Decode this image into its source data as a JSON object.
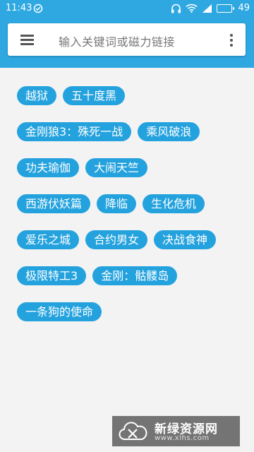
{
  "status_bar": {
    "time": "11:43",
    "battery": "49",
    "icons": [
      "check-circle-icon",
      "headphones-icon",
      "wifi-icon",
      "signal-icon",
      "battery-icon"
    ]
  },
  "search": {
    "placeholder": "输入关键词或磁力链接",
    "left_icon": "menu-icon",
    "right_icon": "more-vertical-icon"
  },
  "tags": [
    "越狱",
    "五十度黑",
    "金刚狼3：殊死一战",
    "乘风破浪",
    "功夫瑜伽",
    "大闹天竺",
    "西游伏妖篇",
    "降临",
    "生化危机",
    "爱乐之城",
    "合约男女",
    "决战食神",
    "极限特工3",
    "金刚：骷髅岛",
    "一条狗的使命"
  ],
  "watermark": {
    "title": "新绿资源网",
    "url": "www.xlhs.com"
  },
  "colors": {
    "primary": "#2fa8e2",
    "tag_bg": "#24a2de",
    "background": "#f3f3f3"
  }
}
